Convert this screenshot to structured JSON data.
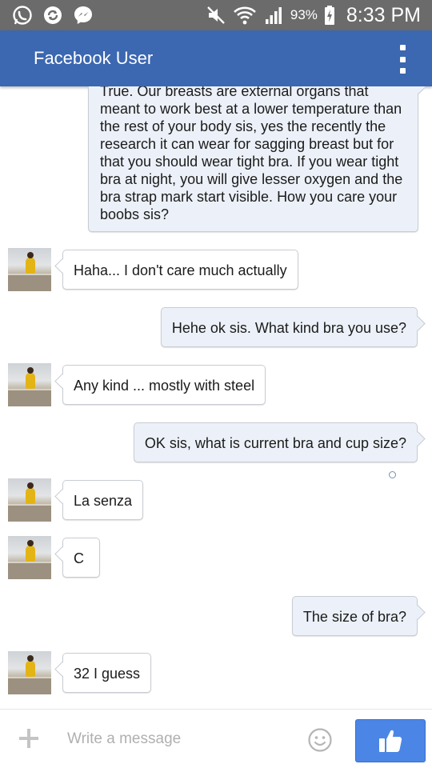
{
  "status_bar": {
    "battery_percent": "93%",
    "time": "8:33 PM",
    "icons": [
      "whatsapp-icon",
      "sync-icon",
      "messenger-icon",
      "mute-icon",
      "wifi-icon",
      "signal-icon",
      "battery-charging-icon"
    ]
  },
  "header": {
    "title": "Facebook User",
    "menu_icon": "overflow-menu-icon"
  },
  "messages": [
    {
      "direction": "out",
      "text": "True. Our breasts are external organs that meant to work best at a lower temperature than the rest of your body sis, yes the recently the research it can wear for sagging breast but for that you should wear tight bra. If you wear tight bra at night, you will give lesser oxygen and the bra strap mark start visible. How you care your boobs sis?"
    },
    {
      "direction": "in",
      "text": "Haha... I don't care much actually"
    },
    {
      "direction": "out",
      "text": "Hehe ok sis. What kind bra you use?"
    },
    {
      "direction": "in",
      "text": "Any kind ... mostly with steel"
    },
    {
      "direction": "out",
      "text": "OK sis, what is current bra and cup size?"
    },
    {
      "direction": "in",
      "text": "La senza"
    },
    {
      "direction": "in",
      "text": "C"
    },
    {
      "direction": "out",
      "text": "The size of bra?"
    },
    {
      "direction": "in",
      "text": "32 I guess"
    }
  ],
  "composer": {
    "placeholder": "Write a message",
    "add_icon": "plus-icon",
    "sticker_icon": "smiley-icon",
    "send_icon": "thumbs-up-icon"
  },
  "colors": {
    "status_bar": "#6b6b6b",
    "app_bar": "#3c67b1",
    "outgoing_bubble": "#ecf1f9",
    "incoming_bubble": "#ffffff",
    "like_button": "#4b86e6"
  }
}
